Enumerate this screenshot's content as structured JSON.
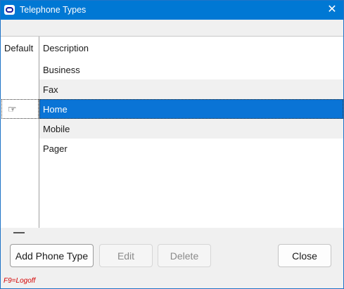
{
  "window": {
    "title": "Telephone Types",
    "close_glyph": "✕",
    "app_icon": "app-s-icon"
  },
  "grid": {
    "headers": {
      "default": "Default",
      "description": "Description"
    },
    "rows": [
      {
        "description": "Business",
        "selected": false,
        "default": false
      },
      {
        "description": "Fax",
        "selected": false,
        "default": false
      },
      {
        "description": "Home",
        "selected": true,
        "default": true
      },
      {
        "description": "Mobile",
        "selected": false,
        "default": false
      },
      {
        "description": "Pager",
        "selected": false,
        "default": false
      }
    ],
    "default_marker_glyph": "☞",
    "selection_color": "#0a74d6"
  },
  "buttons": {
    "add": "Add Phone Type",
    "edit": "Edit",
    "delete": "Delete",
    "close": "Close"
  },
  "status": {
    "text": "F9=Logoff",
    "color": "#d40000"
  }
}
